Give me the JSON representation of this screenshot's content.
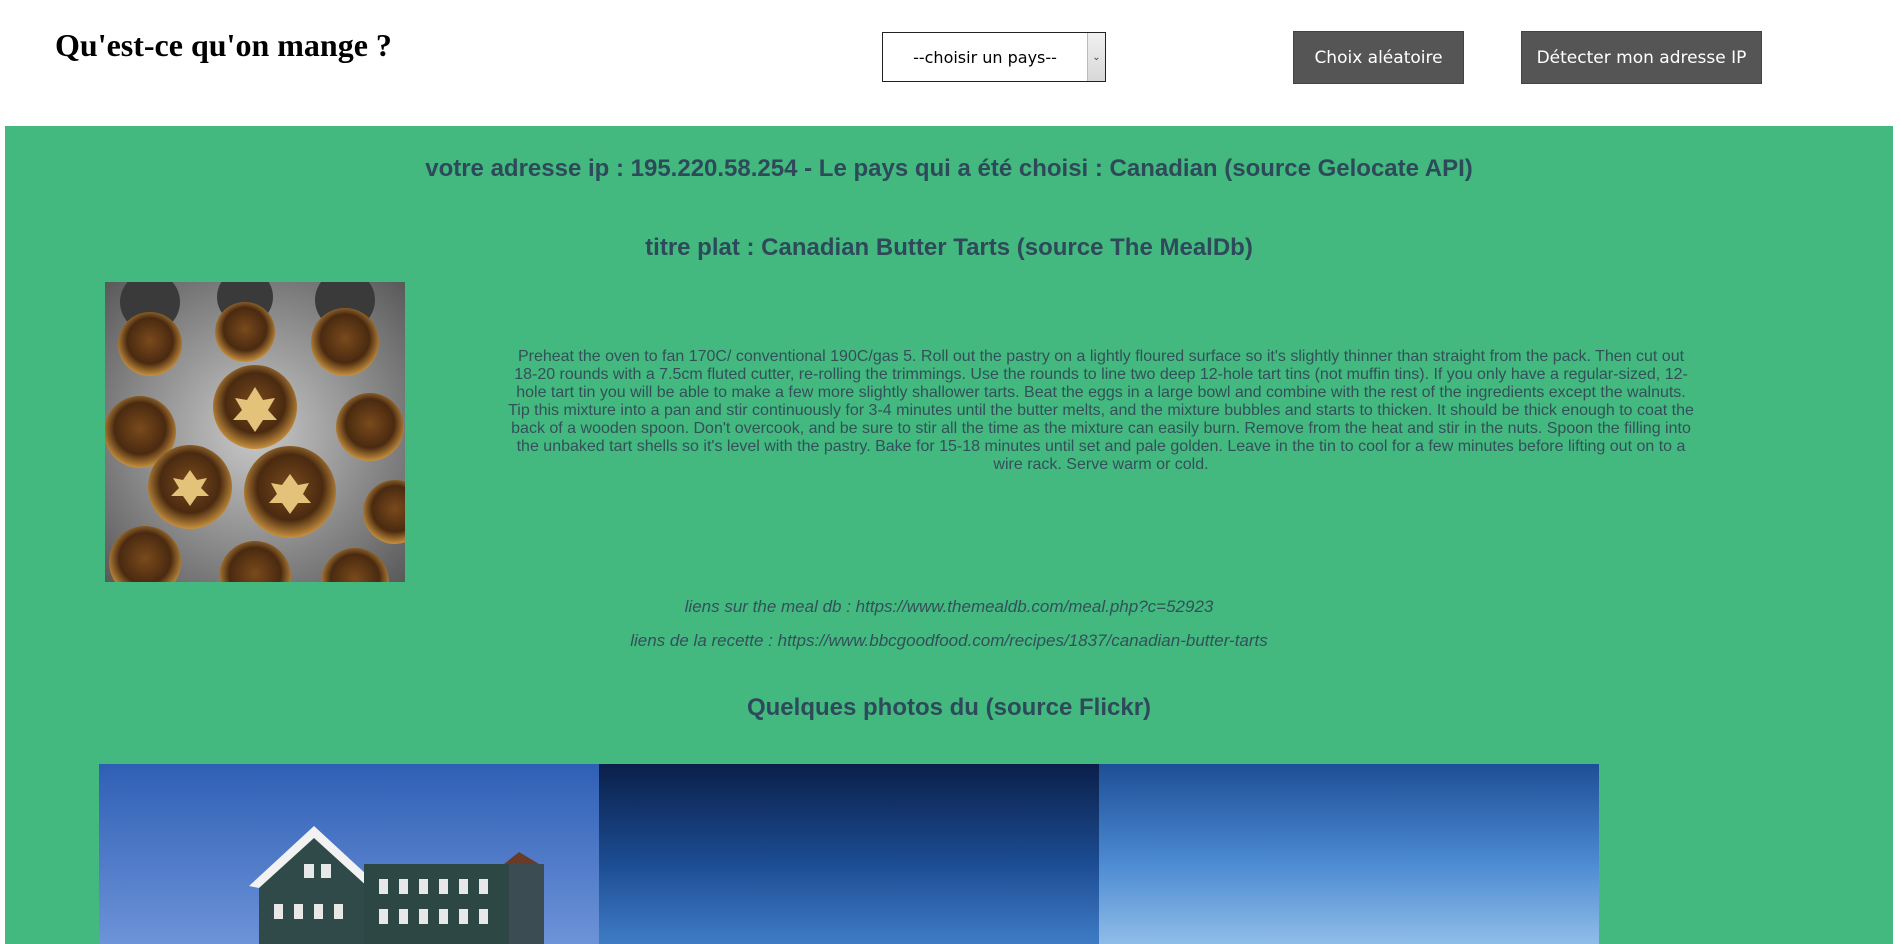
{
  "header": {
    "title": "Qu'est-ce qu'on mange ?",
    "country_select": {
      "selected": "--choisir un pays--"
    },
    "random_button": "Choix aléatoire",
    "detect_ip_button": "Détecter mon adresse IP"
  },
  "main": {
    "ip_info": "votre adresse ip : 195.220.58.254 - Le pays qui a été choisi : Canadian (source Gelocate API)",
    "dish_title": "titre plat : Canadian Butter Tarts (source The MealDb)",
    "instructions": "Preheat the oven to fan 170C/ conventional 190C/gas 5. Roll out the pastry on a lightly floured surface so it's slightly thinner than straight from the pack. Then cut out 18-20 rounds with a 7.5cm fluted cutter, re-rolling the trimmings. Use the rounds to line two deep 12-hole tart tins (not muffin tins). If you only have a regular-sized, 12-hole tart tin you will be able to make a few more slightly shallower tarts. Beat the eggs in a large bowl and combine with the rest of the ingredients except the walnuts. Tip this mixture into a pan and stir continuously for 3-4 minutes until the butter melts, and the mixture bubbles and starts to thicken. It should be thick enough to coat the back of a wooden spoon. Don't overcook, and be sure to stir all the time as the mixture can easily burn. Remove from the heat and stir in the nuts. Spoon the filling into the unbaked tart shells so it's level with the pastry. Bake for 15-18 minutes until set and pale golden. Leave in the tin to cool for a few minutes before lifting out on to a wire rack. Serve warm or cold.",
    "link_mealdb": "liens sur the meal db : https://www.themealdb.com/meal.php?c=52923",
    "link_recipe": "liens de la recette : https://www.bbcgoodfood.com/recipes/1837/canadian-butter-tarts",
    "photos_title": "Quelques photos du (source Flickr)"
  },
  "colors": {
    "main_background": "#43b97f",
    "heading_text": "#2e4a5a",
    "button_background": "#555555"
  }
}
